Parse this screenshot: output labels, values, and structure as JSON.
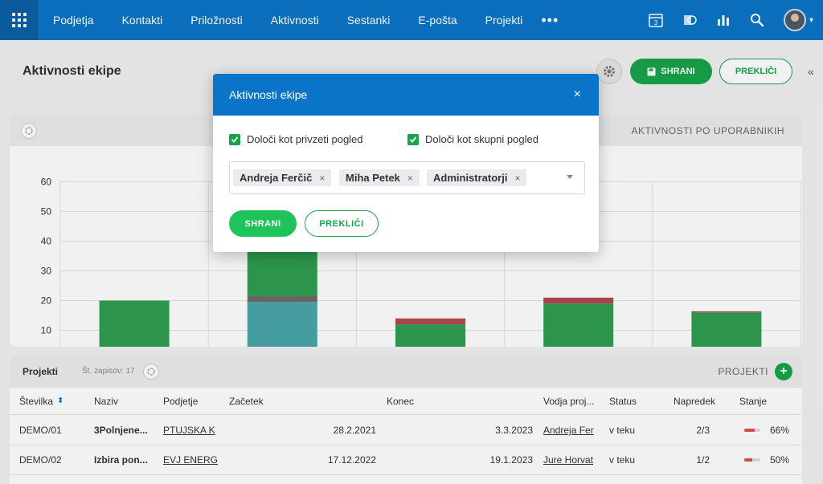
{
  "nav": {
    "items": [
      "Podjetja",
      "Kontakti",
      "Priložnosti",
      "Aktivnosti",
      "Sestanki",
      "E-pošta",
      "Projekti"
    ],
    "more": "•••",
    "calendar_day": "3"
  },
  "page": {
    "title": "Aktivnosti ekipe",
    "save_label": "SHRANI",
    "cancel_label": "PREKLIČI"
  },
  "chart_card": {
    "label": "AKTIVNOSTI PO UPORABNIKIH"
  },
  "chart_data": {
    "type": "bar",
    "stacked": true,
    "categories": [
      "",
      "",
      "",
      "",
      ""
    ],
    "yticks": [
      10,
      20,
      30,
      40,
      50,
      60
    ],
    "ylim": [
      5,
      65
    ],
    "grid": true,
    "series": [
      {
        "color": "#4aa6a8",
        "values": [
          0,
          19.5,
          0,
          0,
          0
        ]
      },
      {
        "color": "#6b6b6b",
        "values": [
          1,
          2,
          0,
          0,
          0
        ]
      },
      {
        "color": "#2e9e4f",
        "values": [
          19,
          50,
          12,
          19,
          16
        ]
      },
      {
        "color": "#b2494f",
        "values": [
          0,
          0,
          2,
          2,
          0.4
        ]
      }
    ]
  },
  "projects": {
    "title": "Projekti",
    "count_label": "Št. zapisov: 17",
    "label": "PROJEKTI",
    "add": "+",
    "columns": [
      "Številka",
      "Naziv",
      "Podjetje",
      "Začetek",
      "Konec",
      "Vodja proj...",
      "Status",
      "Napredek",
      "Stanje"
    ],
    "rows": [
      {
        "number": "DEMO/01",
        "name": "3Polnjene...",
        "company": "PTUJSKA K",
        "start": "28.2.2021",
        "end": "3.3.2023",
        "lead": "Andreja Fer",
        "status": "v teku",
        "progress": "2/3",
        "state": "66%",
        "state_value": 0.66
      },
      {
        "number": "DEMO/02",
        "name": "Izbira pon...",
        "company": "EVJ ENERG",
        "start": "17.12.2022",
        "end": "19.1.2023",
        "lead": "Jure Horvat",
        "status": "v teku",
        "progress": "1/2",
        "state": "50%",
        "state_value": 0.5
      }
    ]
  },
  "modal": {
    "title": "Aktivnosti ekipe",
    "close": "×",
    "check1": "Določi kot privzeti pogled",
    "check2": "Določi kot skupni pogled",
    "tags": [
      "Andreja Ferčič",
      "Miha Petek",
      "Administratorji"
    ],
    "tag_remove": "×",
    "save_label": "SHRANI",
    "cancel_label": "PREKLIČI"
  },
  "colors": {
    "nav_bg": "#0a74c8",
    "accent_green": "#18a34a",
    "modal_header": "#0a74c8"
  }
}
